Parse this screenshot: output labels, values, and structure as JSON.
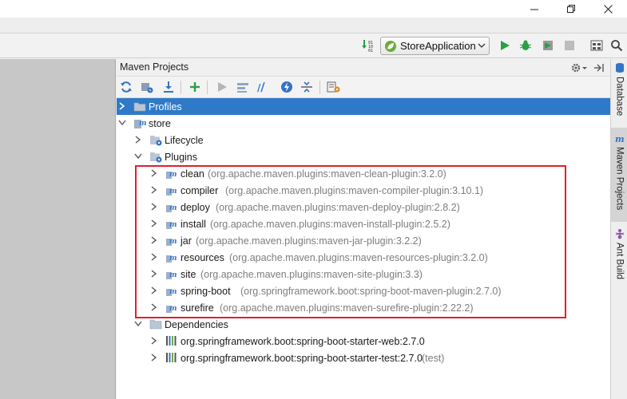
{
  "window": {
    "minimize_icon": "minimize-icon",
    "maximize_icon": "restore-icon",
    "close_icon": "close-icon"
  },
  "navbar": {
    "run_config": "StoreApplication",
    "icons": [
      "make-icon",
      "run-icon",
      "debug-icon",
      "coverage-icon",
      "stop-icon",
      "project-structure-icon",
      "search-icon"
    ]
  },
  "panel": {
    "title": "Maven Projects",
    "header_icons": [
      "gear-icon",
      "hide-icon"
    ],
    "toolbar_icons": [
      "reimport-icon",
      "generate-sources-icon",
      "download-icon",
      "add-icon",
      "run-goal-icon",
      "lifecycle-icon",
      "skip-tests-icon",
      "offline-icon",
      "collapse-icon",
      "settings-icon"
    ]
  },
  "tree": {
    "profiles": "Profiles",
    "store": "store",
    "lifecycle": "Lifecycle",
    "plugins": "Plugins",
    "plugin_items": [
      {
        "name": "clean",
        "coords": "(org.apache.maven.plugins:maven-clean-plugin:3.2.0)"
      },
      {
        "name": "compiler",
        "coords": "(org.apache.maven.plugins:maven-compiler-plugin:3.10.1)"
      },
      {
        "name": "deploy",
        "coords": "(org.apache.maven.plugins:maven-deploy-plugin:2.8.2)"
      },
      {
        "name": "install",
        "coords": "(org.apache.maven.plugins:maven-install-plugin:2.5.2)"
      },
      {
        "name": "jar",
        "coords": "(org.apache.maven.plugins:maven-jar-plugin:3.2.2)"
      },
      {
        "name": "resources",
        "coords": "(org.apache.maven.plugins:maven-resources-plugin:3.2.0)"
      },
      {
        "name": "site",
        "coords": "(org.apache.maven.plugins:maven-site-plugin:3.3)"
      },
      {
        "name": "spring-boot",
        "coords": "(org.springframework.boot:spring-boot-maven-plugin:2.7.0)"
      },
      {
        "name": "surefire",
        "coords": "(org.apache.maven.plugins:maven-surefire-plugin:2.22.2)"
      }
    ],
    "dependencies": "Dependencies",
    "dependency_items": [
      {
        "name": "org.springframework.boot:spring-boot-starter-web:2.7.0",
        "scope": ""
      },
      {
        "name": "org.springframework.boot:spring-boot-starter-test:2.7.0",
        "scope": "(test)"
      }
    ]
  },
  "right_tabs": {
    "database": "Database",
    "maven": "Maven Projects",
    "ant": "Ant Build"
  },
  "colors": {
    "selection": "#2f7ac8",
    "highlight_box": "#e0202c",
    "run_green": "#2aa043"
  }
}
